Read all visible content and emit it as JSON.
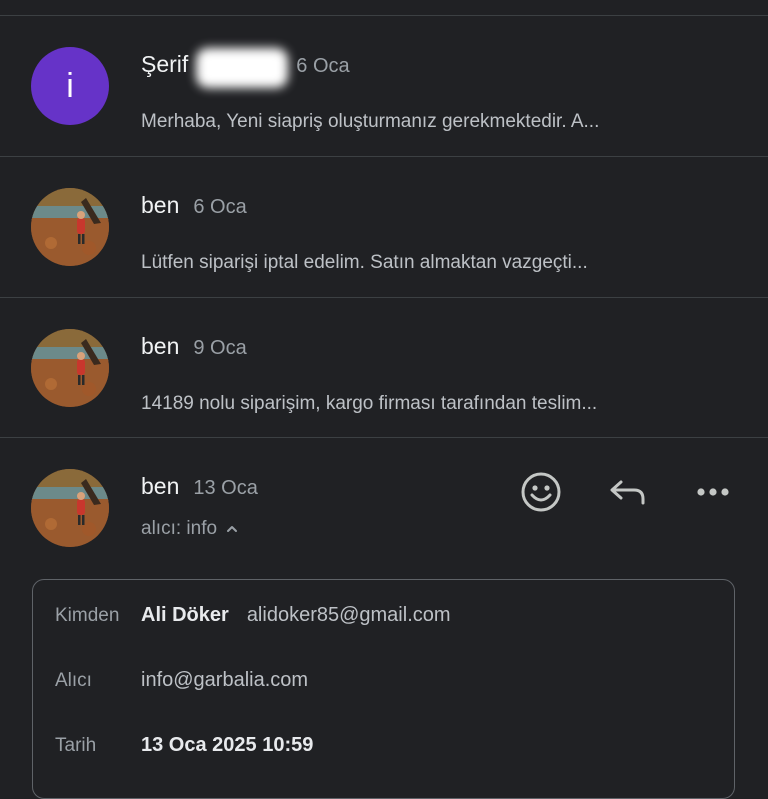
{
  "emails": [
    {
      "sender": "Şerif",
      "date": "6 Oca",
      "snippet": "Merhaba, Yeni siapriş oluşturmanız gerekmektedir. A...",
      "avatar_letter": "i",
      "avatar_color": "#6633c8"
    },
    {
      "sender": "ben",
      "date": "6 Oca",
      "snippet": "Lütfen siparişi iptal edelim. Satın almaktan vazgeçti..."
    },
    {
      "sender": "ben",
      "date": "9 Oca",
      "snippet": "14189 nolu siparişim, kargo firması tarafından teslim..."
    }
  ],
  "open_email": {
    "sender": "ben",
    "date": "13 Oca",
    "recipient_summary": "alıcı: info",
    "actions": [
      "emoji-reaction-icon",
      "reply-icon",
      "more-options-icon"
    ],
    "details": {
      "from_label": "Kimden",
      "from_name": "Ali Döker",
      "from_email": "alidoker85@gmail.com",
      "to_label": "Alıcı",
      "to_value": "info@garbalia.com",
      "date_label": "Tarih",
      "date_value": "13 Oca 2025 10:59"
    }
  },
  "colors": {
    "background": "#202124",
    "divider": "#3c4043",
    "accent_avatar": "#6633c8"
  }
}
